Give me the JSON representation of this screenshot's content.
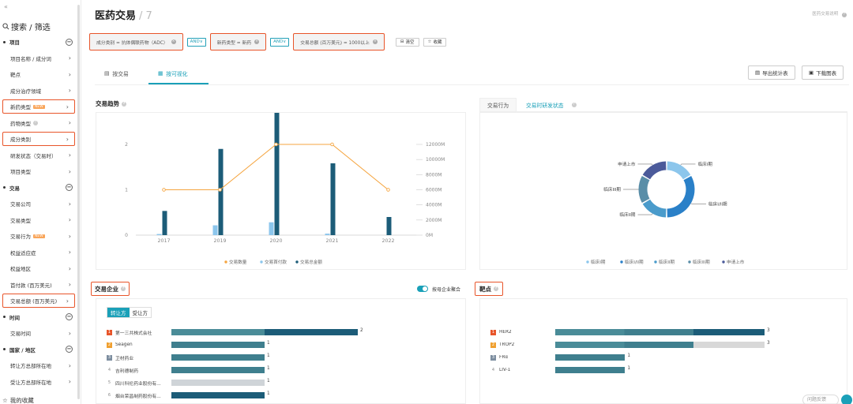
{
  "sidebar": {
    "header": "搜索 / 筛选",
    "groups": [
      {
        "label": "项目",
        "items": [
          "项目名称 / 成分词",
          "靶点",
          "成分治疗领域",
          "新药类型",
          "药物类型",
          "成分类别",
          "研发状态（交易时）",
          "项目类型"
        ]
      },
      {
        "label": "交易",
        "items": [
          "交易公司",
          "交易类型",
          "交易行为",
          "权益适应症",
          "权益地区",
          "首付款 (百万美元)",
          "交易总额 (百万美元)"
        ]
      },
      {
        "label": "时间",
        "items": [
          "交易时间"
        ]
      },
      {
        "label": "国家 / 地区",
        "items": [
          "转让方总部所在地",
          "受让方总部所在地"
        ]
      }
    ],
    "new_badge": "NEW",
    "footer": "我的收藏"
  },
  "page": {
    "title": "医药交易",
    "count": "7",
    "help": "医药交易说明"
  },
  "filters": {
    "chips": [
      "成分类别 = 抗体偶联药物（ADC）",
      "新药类型 = 新药",
      "交易总额 (百万美元) = 1000以上"
    ],
    "and_label": "AND",
    "clear": "清空",
    "favorite": "收藏"
  },
  "view_tabs": [
    "按交易",
    "按可视化"
  ],
  "toolbar": {
    "export": "导出统计表",
    "download": "下载图表"
  },
  "trend": {
    "title": "交易趋势",
    "legend": [
      "交易数量",
      "交易首付款",
      "交易总金额"
    ]
  },
  "right_tabs": [
    "交易行为",
    "交易时研发状态"
  ],
  "donut": {
    "legend": [
      "临床I期",
      "临床I/II期",
      "临床II期",
      "临床III期",
      "申请上市"
    ]
  },
  "company": {
    "title": "交易企业",
    "toggle": "按母企业聚合",
    "seg": [
      "转让方",
      "受让方"
    ]
  },
  "target": {
    "title": "靶点"
  },
  "feedback": "问题反馈",
  "chart_data": [
    {
      "type": "bar",
      "title": "交易趋势",
      "categories": [
        "2017",
        "2019",
        "2020",
        "2021",
        "2022"
      ],
      "series": [
        {
          "name": "交易数量",
          "type": "line",
          "axis": "left",
          "values": [
            1,
            1,
            2,
            2,
            1
          ]
        },
        {
          "name": "交易首付款",
          "type": "bar",
          "axis": "right",
          "values": [
            150,
            1300,
            1700,
            200,
            0
          ]
        },
        {
          "name": "交易总金额",
          "type": "bar",
          "axis": "right",
          "values": [
            3200,
            11400,
            17600,
            9500,
            2400
          ]
        }
      ],
      "ylim_left": [
        0,
        2
      ],
      "ylim_right": [
        0,
        12000
      ],
      "left_ticks": [
        "0",
        "1",
        "2"
      ],
      "right_ticks": [
        "0M",
        "2000M",
        "4000M",
        "6000M",
        "8000M",
        "10000M",
        "12000M"
      ],
      "legend": "bottom",
      "colors": {
        "line": "#f5a540",
        "first_pay": "#8cc6ec",
        "total": "#1c5c78"
      }
    },
    {
      "type": "pie",
      "categories": [
        "临床I期",
        "临床I/II期",
        "临床II期",
        "临床III期",
        "申请上市"
      ],
      "values": [
        1,
        2,
        1,
        1,
        1
      ],
      "colors": [
        "#8cc6ec",
        "#2a80c8",
        "#4a9bcb",
        "#5a8ea8",
        "#4b5a9a"
      ]
    },
    {
      "type": "bar",
      "title": "交易企业",
      "categories": [
        "第一三共株式会社",
        "Seagen",
        "卫材药业",
        "吉利德制药",
        "四川科伦药业股份有...",
        "烟台荣昌制药股份有..."
      ],
      "values": [
        2,
        1,
        1,
        1,
        1,
        1
      ],
      "labels": [
        "2",
        "1",
        "1",
        "1",
        "1",
        "1"
      ]
    },
    {
      "type": "bar",
      "title": "靶点",
      "categories": [
        "HER2",
        "TROP2",
        "FRα",
        "LIV-1"
      ],
      "values": [
        3,
        3,
        1,
        1
      ],
      "labels": [
        "3",
        "3",
        "1",
        "1"
      ]
    }
  ]
}
